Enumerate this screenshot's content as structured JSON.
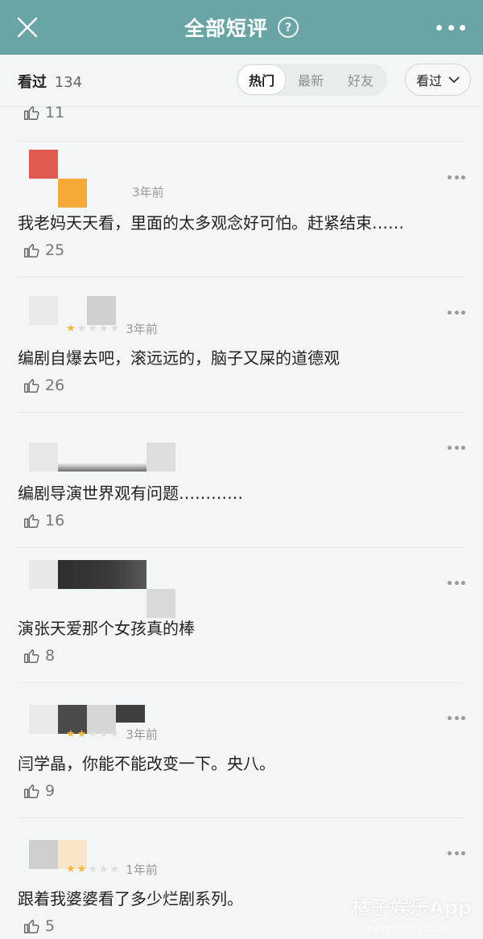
{
  "header": {
    "title": "全部短评",
    "help_icon": "question-circle-icon",
    "close_icon": "close-icon",
    "more_icon": "more-horizontal-icon",
    "bg_color": "#6aa5a6"
  },
  "filter": {
    "seen_label": "看过",
    "seen_count": "134",
    "tabs": [
      {
        "label": "热门",
        "active": true
      },
      {
        "label": "最新",
        "active": false
      },
      {
        "label": "好友",
        "active": false
      }
    ],
    "dropdown_label": "看过"
  },
  "partial_top_likes": "11",
  "comments": [
    {
      "rating": null,
      "time": "3年前",
      "text": "我老妈天天看，里面的太多观念好可怕。赶紧结束……",
      "likes": "25"
    },
    {
      "rating": 1,
      "time": "3年前",
      "text": "编剧自爆去吧，滚远远的，脑子又屎的道德观",
      "likes": "26"
    },
    {
      "rating": null,
      "time": "",
      "text": "编剧导演世界观有问题…………",
      "likes": "16"
    },
    {
      "rating": null,
      "time": "",
      "text": "演张天爱那个女孩真的棒",
      "likes": "8"
    },
    {
      "rating": 2,
      "time": "3年前",
      "text": "闫学晶，你能不能改变一下。央八。",
      "likes": "9"
    },
    {
      "rating": 2,
      "time": "1年前",
      "text": "跟着我婆婆看了多少烂剧系列。",
      "likes": "5"
    }
  ],
  "watermark": {
    "text": "橘子娱乐App",
    "sub": "HAPPYJUZI.COM"
  }
}
